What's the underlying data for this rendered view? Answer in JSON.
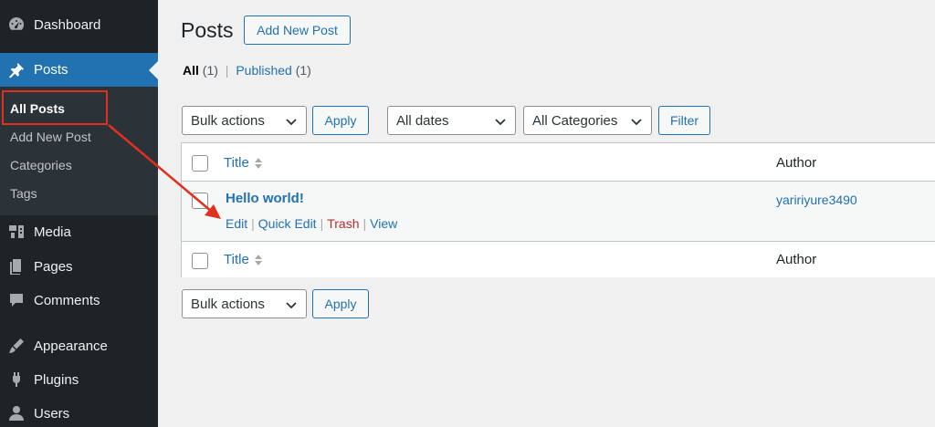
{
  "sidebar": {
    "items": [
      {
        "label": "Dashboard",
        "icon": "dashboard-icon"
      },
      {
        "label": "Posts",
        "icon": "pushpin-icon"
      },
      {
        "label": "Media",
        "icon": "media-icon"
      },
      {
        "label": "Pages",
        "icon": "pages-icon"
      },
      {
        "label": "Comments",
        "icon": "comments-icon"
      },
      {
        "label": "Appearance",
        "icon": "appearance-icon"
      },
      {
        "label": "Plugins",
        "icon": "plugins-icon"
      },
      {
        "label": "Users",
        "icon": "users-icon"
      }
    ],
    "submenu": [
      "All Posts",
      "Add New Post",
      "Categories",
      "Tags"
    ]
  },
  "header": {
    "title": "Posts",
    "add_new_label": "Add New Post"
  },
  "filters": {
    "all_label": "All",
    "all_count": "(1)",
    "separator": "|",
    "published_label": "Published",
    "published_count": "(1)"
  },
  "toolbar": {
    "bulk_actions": "Bulk actions",
    "apply_label": "Apply",
    "dates": "All dates",
    "categories": "All Categories",
    "filter_label": "Filter"
  },
  "table": {
    "col_title": "Title",
    "col_author": "Author",
    "rows": [
      {
        "title": "Hello world!",
        "author": "yaririyure3490",
        "actions": [
          "Edit",
          "Quick Edit",
          "Trash",
          "View"
        ]
      }
    ]
  },
  "colors": {
    "accent": "#2271b1",
    "sidebar_bg": "#1d2327",
    "trash": "#b32d2e",
    "annotation": "#e0301e"
  }
}
